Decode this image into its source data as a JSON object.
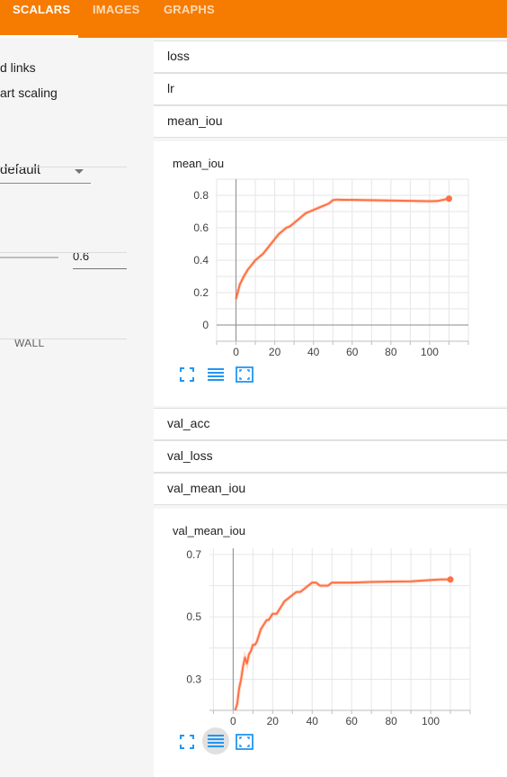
{
  "header": {
    "tabs": [
      {
        "label": "SCALARS",
        "active": true
      },
      {
        "label": "IMAGES",
        "active": false
      },
      {
        "label": "GRAPHS",
        "active": false
      }
    ],
    "accent": "#f57c00"
  },
  "sidebar": {
    "link_text": "d links",
    "scaling_text": "art scaling",
    "select_value": "default",
    "smoothing_value": "0.6",
    "wall_label": "WALL"
  },
  "tags_top": [
    "loss",
    "lr",
    "mean_iou"
  ],
  "tags_bottom": [
    "val_acc",
    "val_loss",
    "val_mean_iou"
  ],
  "chart_data": [
    {
      "type": "line",
      "title": "mean_iou",
      "x_ticks": [
        0,
        20,
        40,
        60,
        80,
        100
      ],
      "y_ticks": [
        0,
        0.2,
        0.4,
        0.6,
        0.8
      ],
      "xlim": [
        -10,
        120
      ],
      "ylim": [
        -0.1,
        0.9
      ],
      "grid": true,
      "series_color": "#ff7043",
      "x": [
        0,
        2,
        4,
        6,
        8,
        10,
        12,
        14,
        16,
        18,
        20,
        22,
        24,
        26,
        28,
        30,
        32,
        34,
        36,
        38,
        40,
        42,
        44,
        46,
        48,
        50,
        52,
        56,
        60,
        70,
        80,
        90,
        100,
        104,
        110
      ],
      "y": [
        0.16,
        0.25,
        0.3,
        0.34,
        0.37,
        0.4,
        0.42,
        0.44,
        0.47,
        0.5,
        0.53,
        0.56,
        0.58,
        0.6,
        0.61,
        0.63,
        0.65,
        0.67,
        0.69,
        0.7,
        0.71,
        0.72,
        0.73,
        0.74,
        0.75,
        0.77,
        0.774,
        0.772,
        0.772,
        0.77,
        0.768,
        0.766,
        0.764,
        0.765,
        0.78
      ]
    },
    {
      "type": "line",
      "title": "val_mean_iou",
      "x_ticks": [
        0,
        20,
        40,
        60,
        80,
        100
      ],
      "y_ticks": [
        0.3,
        0.5,
        0.7
      ],
      "xlim": [
        -12,
        120
      ],
      "ylim": [
        0.2,
        0.72
      ],
      "grid": true,
      "series_color": "#ff7043",
      "x": [
        1,
        2,
        3,
        4,
        5,
        6,
        7,
        8,
        9,
        10,
        11,
        12,
        13,
        14,
        15,
        16,
        17,
        18,
        19,
        20,
        22,
        24,
        26,
        28,
        30,
        32,
        34,
        36,
        38,
        40,
        42,
        44,
        46,
        48,
        50,
        55,
        60,
        70,
        80,
        90,
        100,
        105,
        110
      ],
      "y": [
        0.2,
        0.22,
        0.27,
        0.3,
        0.34,
        0.37,
        0.35,
        0.38,
        0.39,
        0.41,
        0.41,
        0.42,
        0.44,
        0.46,
        0.47,
        0.48,
        0.49,
        0.49,
        0.5,
        0.51,
        0.51,
        0.53,
        0.55,
        0.56,
        0.57,
        0.58,
        0.58,
        0.59,
        0.6,
        0.61,
        0.61,
        0.6,
        0.6,
        0.6,
        0.61,
        0.61,
        0.61,
        0.612,
        0.613,
        0.614,
        0.618,
        0.62,
        0.62
      ]
    }
  ]
}
